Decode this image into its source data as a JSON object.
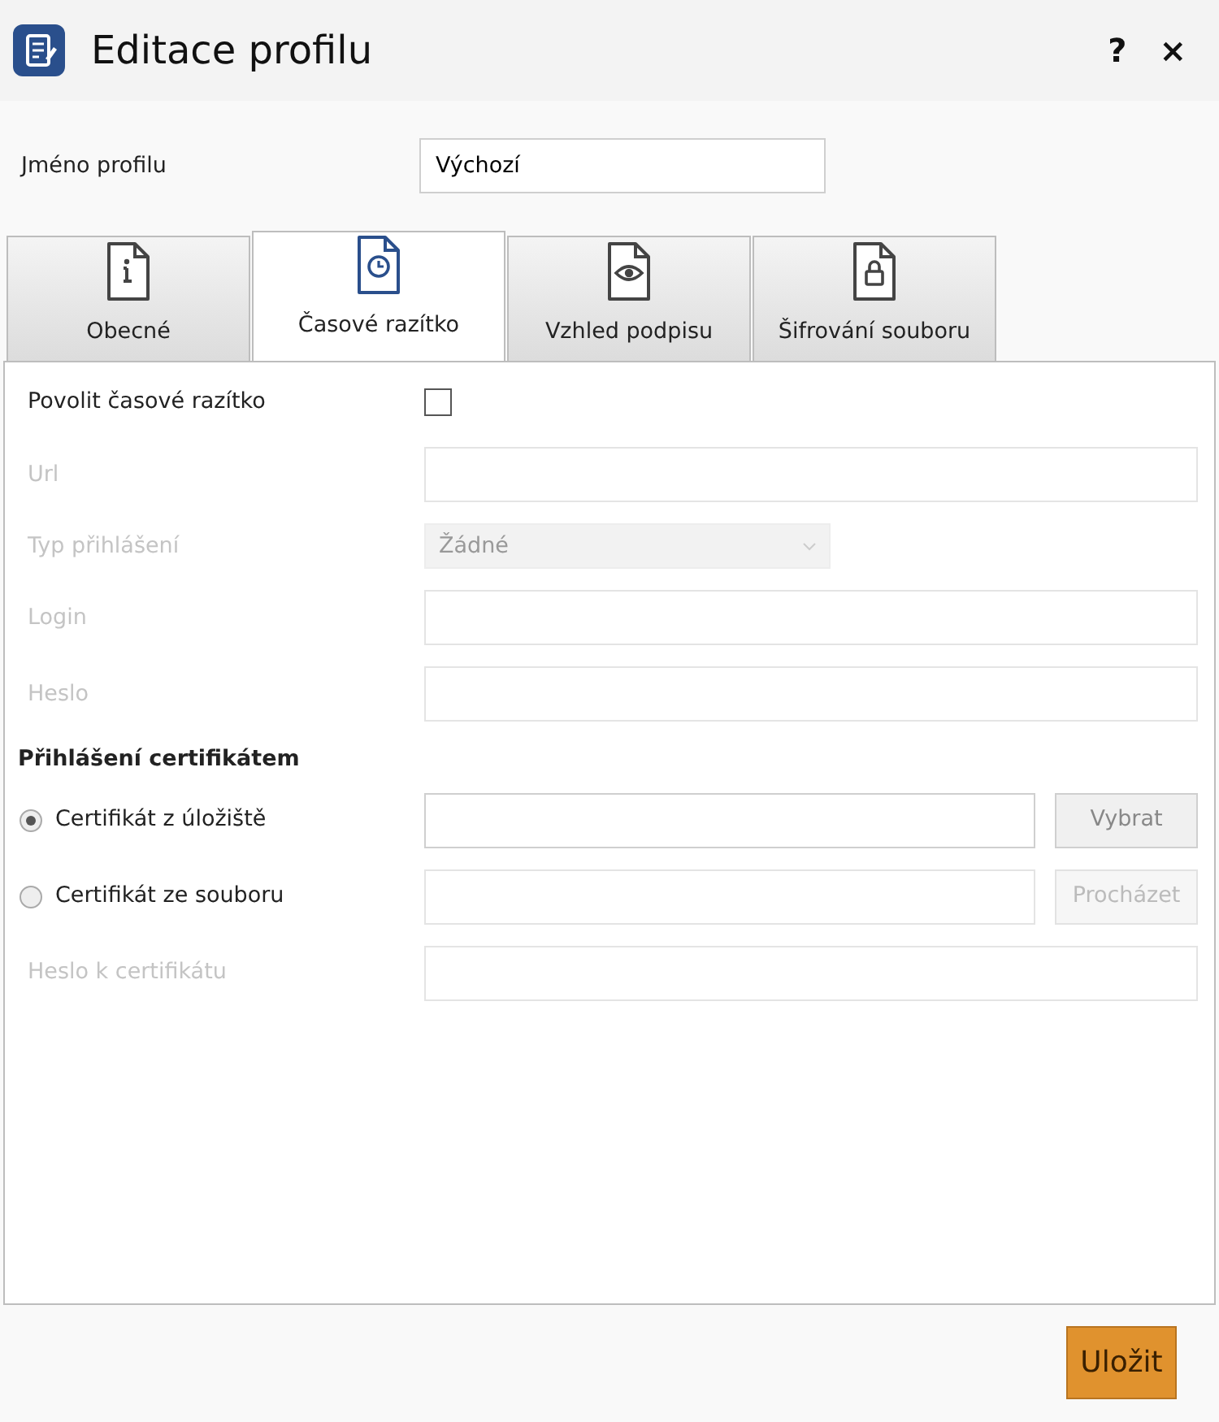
{
  "window": {
    "title": "Editace profilu",
    "help": "?",
    "close": "×"
  },
  "profile_name": {
    "label": "Jméno profilu",
    "value": "Výchozí"
  },
  "tabs": [
    {
      "label": "Obecné",
      "selected": false
    },
    {
      "label": "Časové razítko",
      "selected": true
    },
    {
      "label": "Vzhled podpisu",
      "selected": false
    },
    {
      "label": "Šifrování souboru",
      "selected": false
    }
  ],
  "form": [
    {
      "kind": "checkbox",
      "label": "Povolit časové razítko",
      "checked": false
    },
    {
      "kind": "text",
      "label": "Url",
      "disabled": true
    },
    {
      "kind": "select",
      "label": "Typ přihlášení",
      "value": "Žádné",
      "disabled": true
    },
    {
      "kind": "text",
      "label": "Login",
      "disabled": true
    },
    {
      "kind": "text",
      "label": "Heslo",
      "disabled": true
    },
    {
      "kind": "heading",
      "label": "Přihlášení certifikátem"
    },
    {
      "kind": "radio",
      "label": "Certifikát z úložiště",
      "selected": true,
      "button": "Vybrat",
      "disabled": false
    },
    {
      "kind": "radio",
      "label": "Certifikát ze souboru",
      "selected": false,
      "button": "Procházet",
      "disabled": true
    },
    {
      "kind": "text",
      "label": "Heslo k certifikátu",
      "disabled": true
    }
  ],
  "save_button": "Uložit"
}
